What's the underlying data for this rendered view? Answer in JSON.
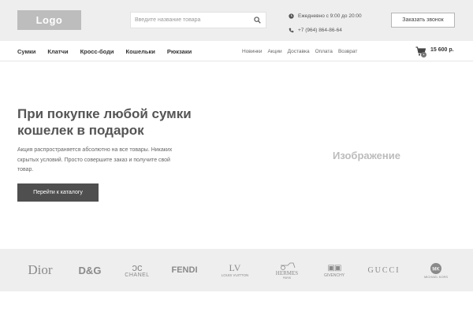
{
  "header": {
    "logo": "Logo",
    "search_placeholder": "Введите название товара",
    "hours": "Ежедневно с 9:00 до 20:00",
    "phone": "+7 (964) 864-86-64",
    "callback_label": "Заказать звонок"
  },
  "nav": {
    "categories": [
      "Сумки",
      "Клатчи",
      "Кросс-боди",
      "Кошельки",
      "Рюкзаки"
    ],
    "links": [
      "Новинки",
      "Акции",
      "Доставка",
      "Оплата",
      "Возврат"
    ],
    "cart_total": "15 600 р."
  },
  "hero": {
    "title": "При покупке любой сумки кошелек в подарок",
    "text": "Акция распространяется абсолютно на все товары. Никаких скрытых условий. Просто совершите заказ и получите свой товар.",
    "button_label": "Перейти к каталогу",
    "image_placeholder": "Изображение"
  },
  "brands": [
    {
      "name": "Dior"
    },
    {
      "name": "D&G"
    },
    {
      "name": "CHANEL"
    },
    {
      "name": "FENDI"
    },
    {
      "name": "LOUIS VUITTON"
    },
    {
      "name": "HERMES",
      "sub": "PARIS"
    },
    {
      "name": "GIVENCHY"
    },
    {
      "name": "GUCCI"
    },
    {
      "name": "MICHAEL KORS"
    }
  ],
  "colors": {
    "header_bg": "#eeeeee",
    "button_bg": "#4f4f4f",
    "logo_bg": "#bdbdbd"
  }
}
